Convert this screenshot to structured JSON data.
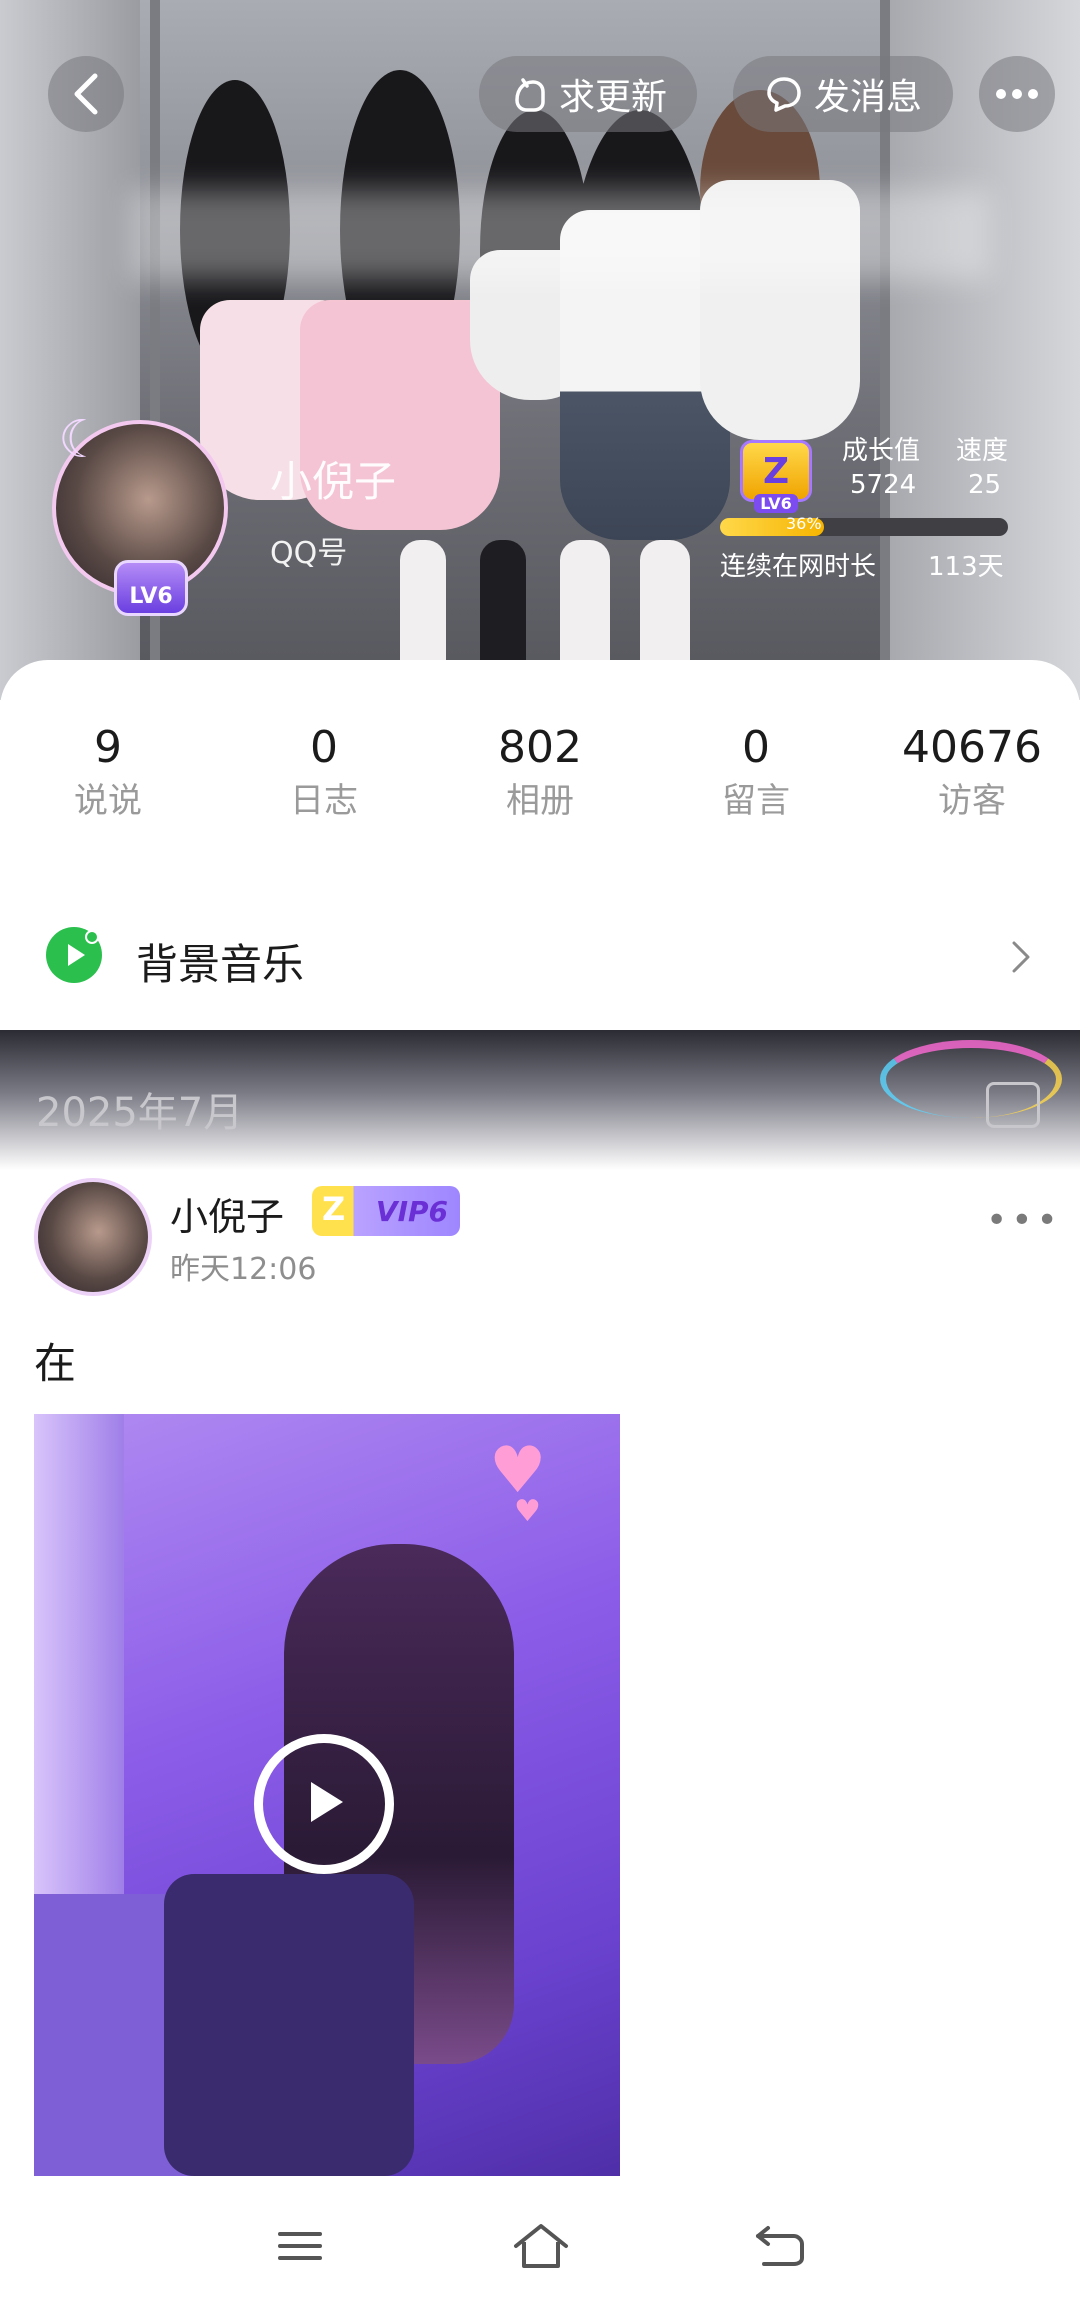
{
  "header": {
    "request_update_label": "求更新",
    "send_message_label": "发消息"
  },
  "profile": {
    "name": "小倪子",
    "qq_label": "QQ号",
    "level_badge": "LV6",
    "growth_label": "成长值",
    "growth_value": "5724",
    "speed_label": "速度",
    "speed_value": "25",
    "progress_percent": 36,
    "progress_text": "36%",
    "online_label": "连续在网时长",
    "online_days": "113天"
  },
  "stats": [
    {
      "value": "9",
      "label": "说说"
    },
    {
      "value": "0",
      "label": "日志"
    },
    {
      "value": "802",
      "label": "相册"
    },
    {
      "value": "0",
      "label": "留言"
    },
    {
      "value": "40676",
      "label": "访客"
    }
  ],
  "music": {
    "label": "背景音乐"
  },
  "feed": {
    "month": "2025年7月"
  },
  "post": {
    "author": "小倪子",
    "vip_badge": "VIP6",
    "time": "昨天12:06",
    "text": "在"
  },
  "colors": {
    "accent_green": "#2bc04e",
    "vip_gold": "#ffe14d",
    "vip_purple": "#9e86ff"
  },
  "icons": {
    "back": "chevron-left-icon",
    "more": "ellipsis-icon",
    "request": "hand-wave-icon",
    "message": "chat-bubble-icon",
    "music": "music-disc-icon",
    "play": "play-icon",
    "nav_menu": "menu-icon",
    "nav_home": "home-icon",
    "nav_back": "return-icon"
  }
}
